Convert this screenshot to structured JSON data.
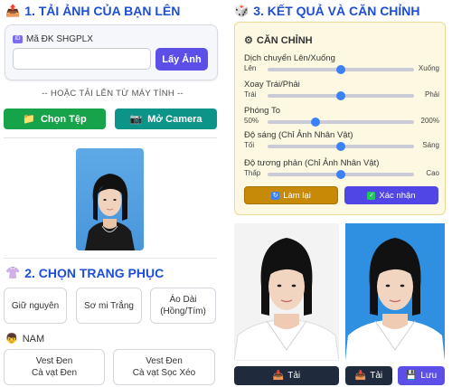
{
  "section1": {
    "title": "1. TẢI ẢNH CỦA BẠN LÊN",
    "ma_label": "Mã ĐK SHGPLX",
    "ma_value": "",
    "ma_placeholder": "",
    "lay_anh": "Lấy Ảnh",
    "or_text": "-- HOẶC TẢI LÊN TỪ MÁY TÍNH --",
    "chon_tep": "Chọn Tệp",
    "mo_camera": "Mở Camera"
  },
  "section2": {
    "title": "2. CHỌN TRANG PHỤC",
    "options": [
      "Giữ nguyên",
      "Sơ mi Trắng",
      "Áo Dài\n(Hồng/Tím)"
    ],
    "gender": "NAM",
    "male_options": [
      "Vest Đen\nCà vạt Đen",
      "Vest Đen\nCà vạt Sọc Xéo"
    ]
  },
  "section3": {
    "title": "3. KẾT QUẢ VÀ CĂN CHỈNH",
    "adjust_title": "CĂN CHỈNH",
    "sliders": [
      {
        "label": "Dịch chuyển Lên/Xuống",
        "min_label": "Lên",
        "max_label": "Xuống",
        "value": 0.5
      },
      {
        "label": "Xoay Trái/Phải",
        "min_label": "Trái",
        "max_label": "Phải",
        "value": 0.5
      },
      {
        "label": "Phóng To",
        "min_label": "50%",
        "max_label": "200%",
        "value": 0.33
      },
      {
        "label": "Độ sáng (Chỉ Ảnh Nhân Vật)",
        "min_label": "Tối",
        "max_label": "Sáng",
        "value": 0.5
      },
      {
        "label": "Độ tương phản (Chỉ Ảnh Nhân Vật)",
        "min_label": "Thấp",
        "max_label": "Cao",
        "value": 0.5
      }
    ],
    "lam_lai": "Làm lại",
    "xac_nhan": "Xác nhận",
    "tai_1": "Tải",
    "tai_2": "Tải",
    "luu": "Lưu"
  },
  "colors": {
    "accent": "#1d4ed8",
    "purple_button": "#5b4fe8",
    "green_button": "#16a34a",
    "teal_button": "#0d9488",
    "orange_button": "#c68a06",
    "dark_button": "#1f2a3d",
    "photo_blue": "#2f8fe0"
  },
  "icons": [
    "upload-icon",
    "id-card-icon",
    "folder-icon",
    "camera-icon",
    "shirt-icon",
    "boy-face-icon",
    "dice-icon",
    "gear-icon",
    "refresh-icon",
    "check-icon",
    "download-icon",
    "save-icon"
  ]
}
